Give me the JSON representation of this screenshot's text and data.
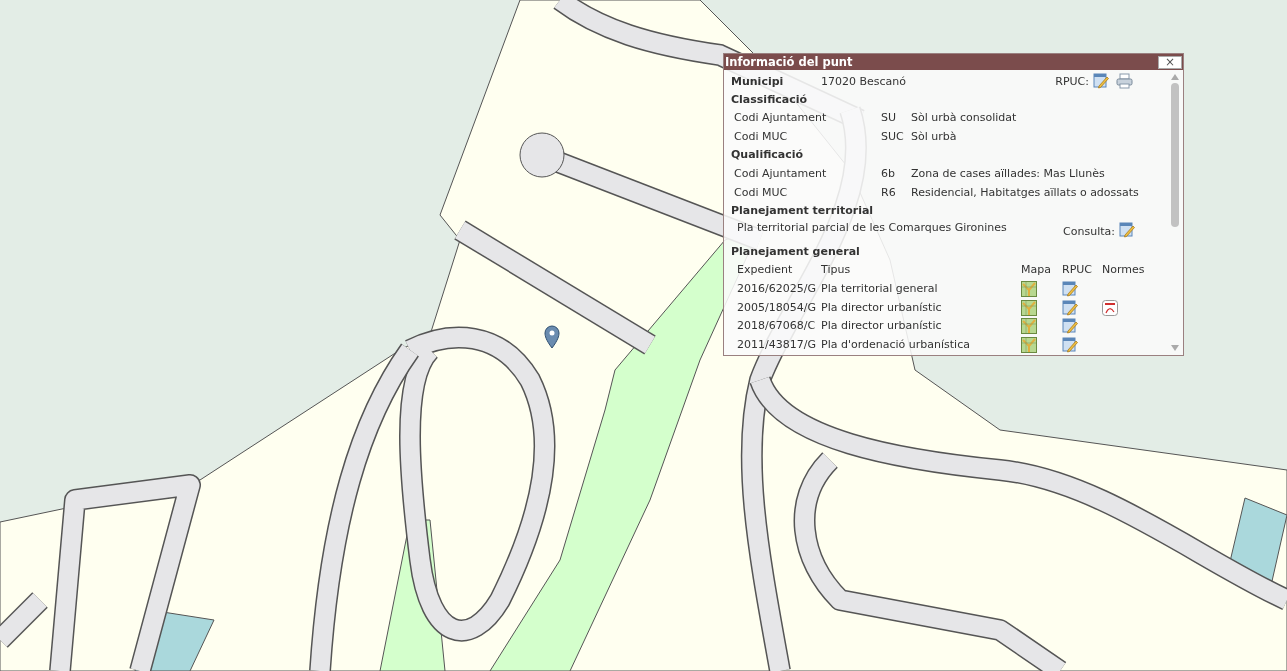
{
  "popup": {
    "title": "Informació del punt",
    "close": "×",
    "municipi": {
      "label": "Municipi",
      "value": "17020 Bescanó",
      "rpuc_label": "RPUC:"
    },
    "sections": [
      {
        "title": "Classificació",
        "rows": [
          {
            "label": "Codi Ajuntament",
            "code": "SU",
            "description": "Sòl urbà consolidat"
          },
          {
            "label": "Codi MUC",
            "code": "SUC",
            "description": "Sòl urbà"
          }
        ]
      },
      {
        "title": "Qualificació",
        "rows": [
          {
            "label": "Codi Ajuntament",
            "code": "6b",
            "description": "Zona de cases aïllades: Mas Llunès"
          },
          {
            "label": "Codi MUC",
            "code": "R6",
            "description": "Residencial, Habitatges aïllats o adossats"
          }
        ]
      }
    ],
    "territorial": {
      "title": "Planejament territorial",
      "plan": "Pla territorial parcial de les Comarques Gironines",
      "consulta_label": "Consulta:"
    },
    "general": {
      "title": "Planejament general",
      "columns": [
        "Expedient",
        "Tipus",
        "Mapa",
        "RPUC",
        "Normes"
      ],
      "rows": [
        {
          "expedient": "2016/62025/G",
          "tipus": "Pla territorial general",
          "normes": false
        },
        {
          "expedient": "2005/18054/G",
          "tipus": "Pla director urbanístic",
          "normes": true
        },
        {
          "expedient": "2018/67068/C",
          "tipus": "Pla director urbanístic",
          "normes": false
        },
        {
          "expedient": "2011/43817/G",
          "tipus": "Pla d'ordenació urbanística",
          "normes": false
        }
      ]
    }
  }
}
